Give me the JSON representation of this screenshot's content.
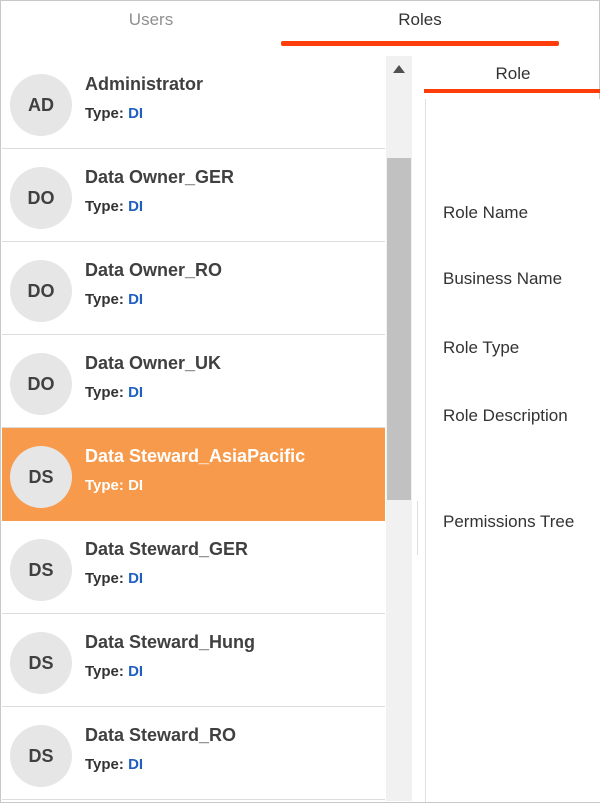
{
  "tabs": {
    "users": "Users",
    "roles": "Roles"
  },
  "roles": [
    {
      "initials": "AD",
      "name": "Administrator",
      "type_label": "Type:",
      "type_value": "DI",
      "selected": false
    },
    {
      "initials": "DO",
      "name": "Data Owner_GER",
      "type_label": "Type:",
      "type_value": "DI",
      "selected": false
    },
    {
      "initials": "DO",
      "name": "Data Owner_RO",
      "type_label": "Type:",
      "type_value": "DI",
      "selected": false
    },
    {
      "initials": "DO",
      "name": "Data Owner_UK",
      "type_label": "Type:",
      "type_value": "DI",
      "selected": false
    },
    {
      "initials": "DS",
      "name": "Data Steward_AsiaPacific",
      "type_label": "Type:",
      "type_value": "DI",
      "selected": true
    },
    {
      "initials": "DS",
      "name": "Data Steward_GER",
      "type_label": "Type:",
      "type_value": "DI",
      "selected": false
    },
    {
      "initials": "DS",
      "name": "Data Steward_Hung",
      "type_label": "Type:",
      "type_value": "DI",
      "selected": false
    },
    {
      "initials": "DS",
      "name": "Data Steward_RO",
      "type_label": "Type:",
      "type_value": "DI",
      "selected": false
    }
  ],
  "detail": {
    "tab_label": "Role",
    "fields": {
      "role_name": "Role Name",
      "business_name": "Business Name",
      "role_type": "Role Type",
      "role_description": "Role Description",
      "permissions_tree": "Permissions Tree"
    }
  },
  "colors": {
    "accent": "#ff3d0a",
    "selected_row": "#f79a4b",
    "type_value": "#1f5fbf",
    "avatar_bg": "#e6e6e6"
  },
  "icons": {
    "scroll_up": "triangle-up-icon"
  }
}
